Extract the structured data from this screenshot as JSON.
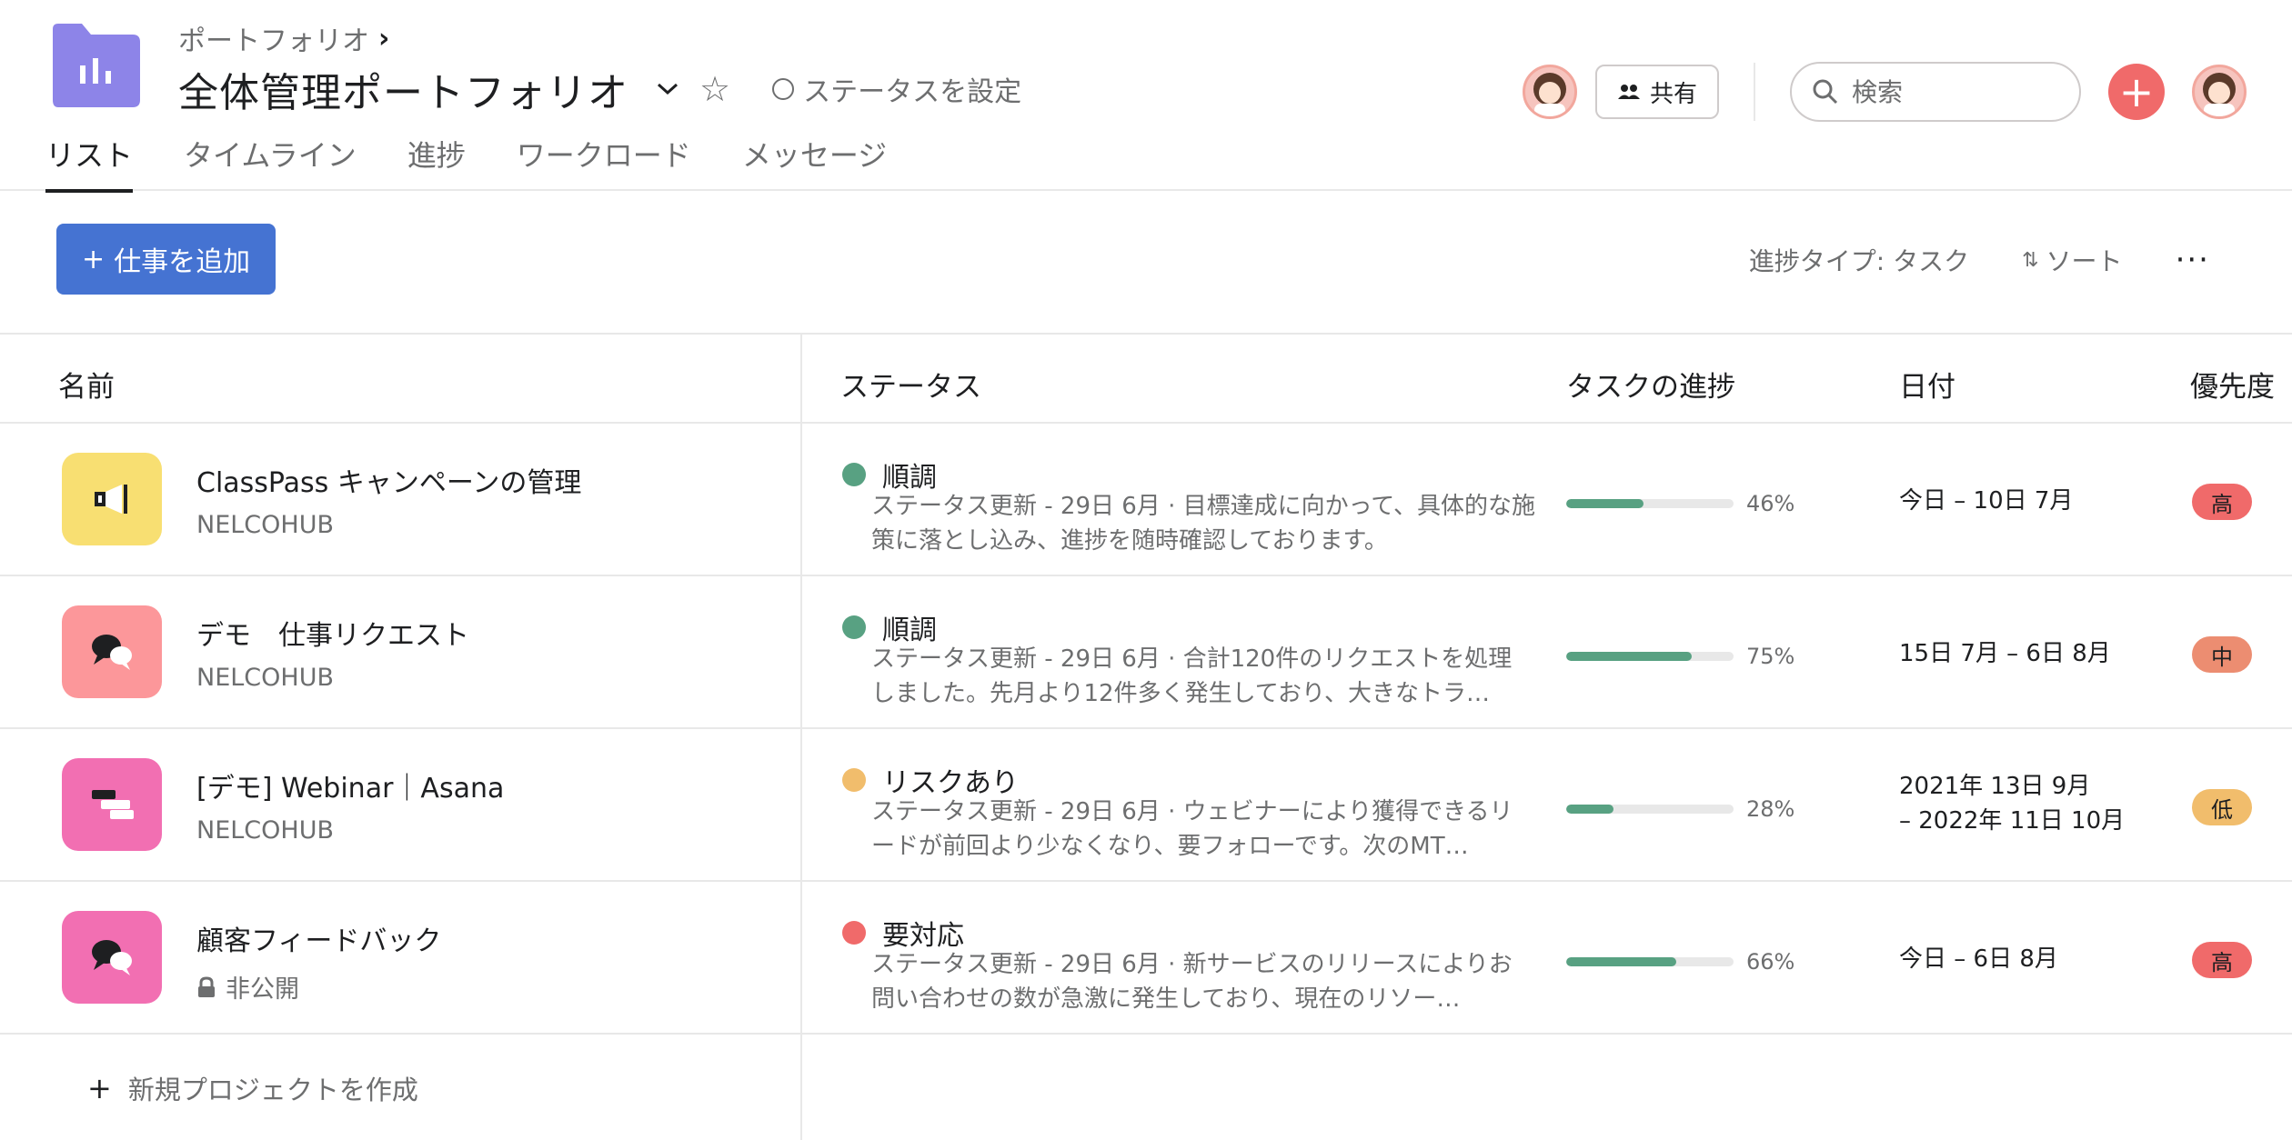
{
  "header": {
    "breadcrumb": "ポートフォリオ",
    "title": "全体管理ポートフォリオ",
    "set_status": "ステータスを設定",
    "share_label": "共有",
    "search_placeholder": "検索"
  },
  "tabs": [
    {
      "label": "リスト",
      "active": true
    },
    {
      "label": "タイムライン"
    },
    {
      "label": "進捗"
    },
    {
      "label": "ワークロード"
    },
    {
      "label": "メッセージ"
    }
  ],
  "toolbar": {
    "add_work": "仕事を追加",
    "progress_type": "進捗タイプ: タスク",
    "sort": "ソート"
  },
  "columns": {
    "name": "名前",
    "status": "ステータス",
    "progress": "タスクの進捗",
    "date": "日付",
    "priority": "優先度"
  },
  "projects": [
    {
      "name": "ClassPass キャンペーンの管理",
      "team": "NELCOHUB",
      "icon": "megaphone-icon",
      "icon_color": "#f8df72",
      "status": "順調",
      "status_color": "#58a182",
      "status_desc": "ステータス更新 - 29日 6月 · 目標達成に向かって、具体的な施策に落とし込み、進捗を随時確認しております。",
      "progress": 46,
      "progress_label": "46%",
      "date": "今日 – 10日 7月",
      "priority": "高",
      "priority_color": "#f06a6a"
    },
    {
      "name": "デモ　仕事リクエスト",
      "team": "NELCOHUB",
      "icon": "chat-bubbles-icon",
      "icon_color": "#fc979a",
      "status": "順調",
      "status_color": "#58a182",
      "status_desc": "ステータス更新 - 29日 6月 · 合計120件のリクエストを処理しました。先月より12件多く発生しており、大きなトラ…",
      "progress": 75,
      "progress_label": "75%",
      "date": "15日 7月 – 6日 8月",
      "priority": "中",
      "priority_color": "#ec8d71"
    },
    {
      "name": "[デモ] Webinar｜Asana",
      "team": "NELCOHUB",
      "icon": "timeline-icon",
      "icon_color": "#f26fb2",
      "status": "リスクあり",
      "status_color": "#f1bd6c",
      "status_desc": "ステータス更新 - 29日 6月 · ウェビナーにより獲得できるリードが前回より少なくなり、要フォローです。次のMT…",
      "progress": 28,
      "progress_label": "28%",
      "date_line1": "2021年 13日 9月",
      "date_line2": "– 2022年 11日 10月",
      "priority": "低",
      "priority_color": "#f1bd6c"
    },
    {
      "name": "顧客フィードバック",
      "team": "非公開",
      "icon": "chat-bubbles-icon",
      "icon_color": "#f26fb2",
      "status": "要対応",
      "status_color": "#f06a6a",
      "status_desc": "ステータス更新 - 29日 6月 · 新サービスのリリースによりお問い合わせの数が急激に発生しており、現在のリソー…",
      "progress": 66,
      "progress_label": "66%",
      "date": "今日 – 6日 8月",
      "priority": "高",
      "priority_color": "#f06a6a"
    }
  ],
  "footer": {
    "new_project": "新規プロジェクトを作成"
  }
}
